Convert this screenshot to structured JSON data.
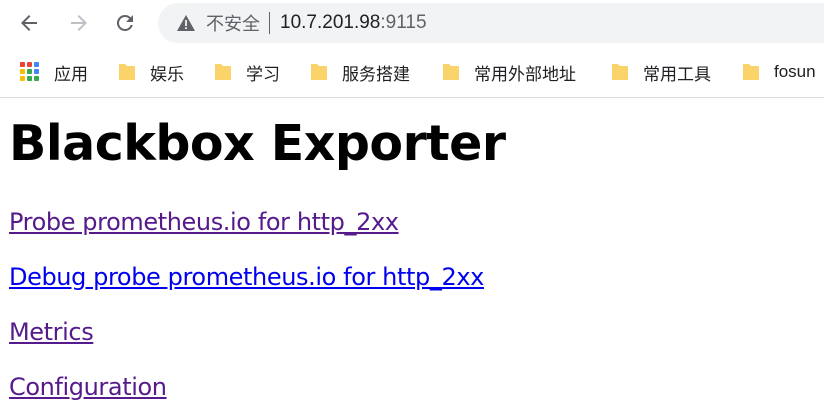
{
  "toolbar": {
    "security_label": "不安全",
    "url_host": "10.7.201.98",
    "url_port": ":9115"
  },
  "bookmarks": {
    "apps_label": "应用",
    "items": [
      {
        "label": "娱乐"
      },
      {
        "label": "学习"
      },
      {
        "label": "服务搭建"
      },
      {
        "label": "常用外部地址"
      },
      {
        "label": "常用工具"
      },
      {
        "label": "fosun"
      }
    ]
  },
  "page": {
    "title": "Blackbox Exporter",
    "links": [
      {
        "label": "Probe prometheus.io for http_2xx"
      },
      {
        "label": "Debug probe prometheus.io for http_2xx"
      },
      {
        "label": "Metrics"
      },
      {
        "label": "Configuration"
      }
    ]
  },
  "colors": {
    "visited_link": "#551a8b",
    "unvisited_link": "#0000ee",
    "folder": "#fbd36b",
    "omnibox_bg": "#f1f3f4"
  }
}
